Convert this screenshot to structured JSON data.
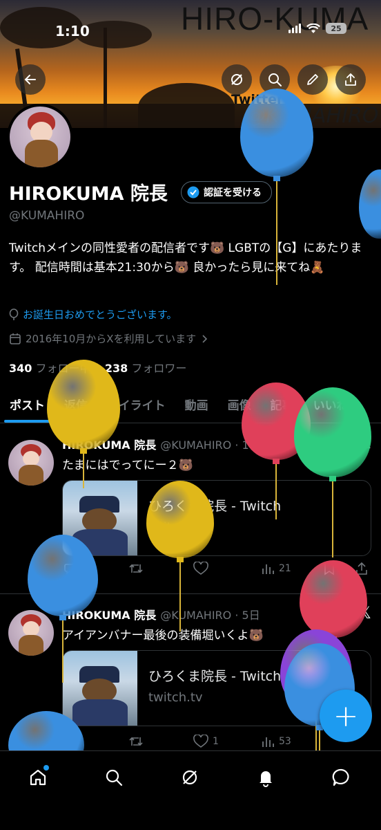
{
  "status_bar": {
    "time": "1:10",
    "battery": "25"
  },
  "banner": {
    "title": "HIRO-KUMA",
    "twitter": "Twitter",
    "handle": "@KUMAHIRO"
  },
  "profile": {
    "name": "HIROKUMA 院長",
    "verify_button": "認証を受ける",
    "handle": "@KUMAHIRO",
    "bio": "Twitchメインの同性愛者の配信者です🐻 LGBTの【G】にあたります。 配信時間は基本21:30から🐻 良かったら見に来てね🧸",
    "birthday": "お誕生日おめでとうございます。",
    "joined": "2016年10月からXを利用しています",
    "following_count": "340",
    "following_label": "フォロー中",
    "followers_count": "238",
    "followers_label": "フォロワー"
  },
  "tabs": [
    "ポスト",
    "返信",
    "ハイライト",
    "動画",
    "画像",
    "記事",
    "いいね"
  ],
  "posts": [
    {
      "name": "HIROKUMA 院長",
      "meta": "@KUMAHIRO · 1日",
      "text": "たまにはでってにー２🐻",
      "card_title": "ひろくま院長 - Twitch",
      "card_domain": "twitch.tv",
      "views": "21"
    },
    {
      "name": "HIROKUMA 院長",
      "meta": "@KUMAHIRO · 5日",
      "text": "アイアンバナー最後の装備堀いくよ🐻",
      "card_title": "ひろくま院長 - Twitch",
      "card_domain": "twitch.tv",
      "likes": "1",
      "views": "53"
    }
  ],
  "fab": "+",
  "icons": [
    "back-arrow-icon",
    "grok-icon",
    "search-icon",
    "edit-icon",
    "share-icon",
    "verified-badge-icon",
    "balloon-location-icon",
    "calendar-icon",
    "x-logo-icon",
    "reply-icon",
    "retweet-icon",
    "like-icon",
    "views-icon",
    "bookmark-icon",
    "home-icon",
    "notifications-icon",
    "messages-icon"
  ],
  "colors": {
    "accent": "#1d9bf0",
    "background": "#000000",
    "muted": "#71767b"
  }
}
